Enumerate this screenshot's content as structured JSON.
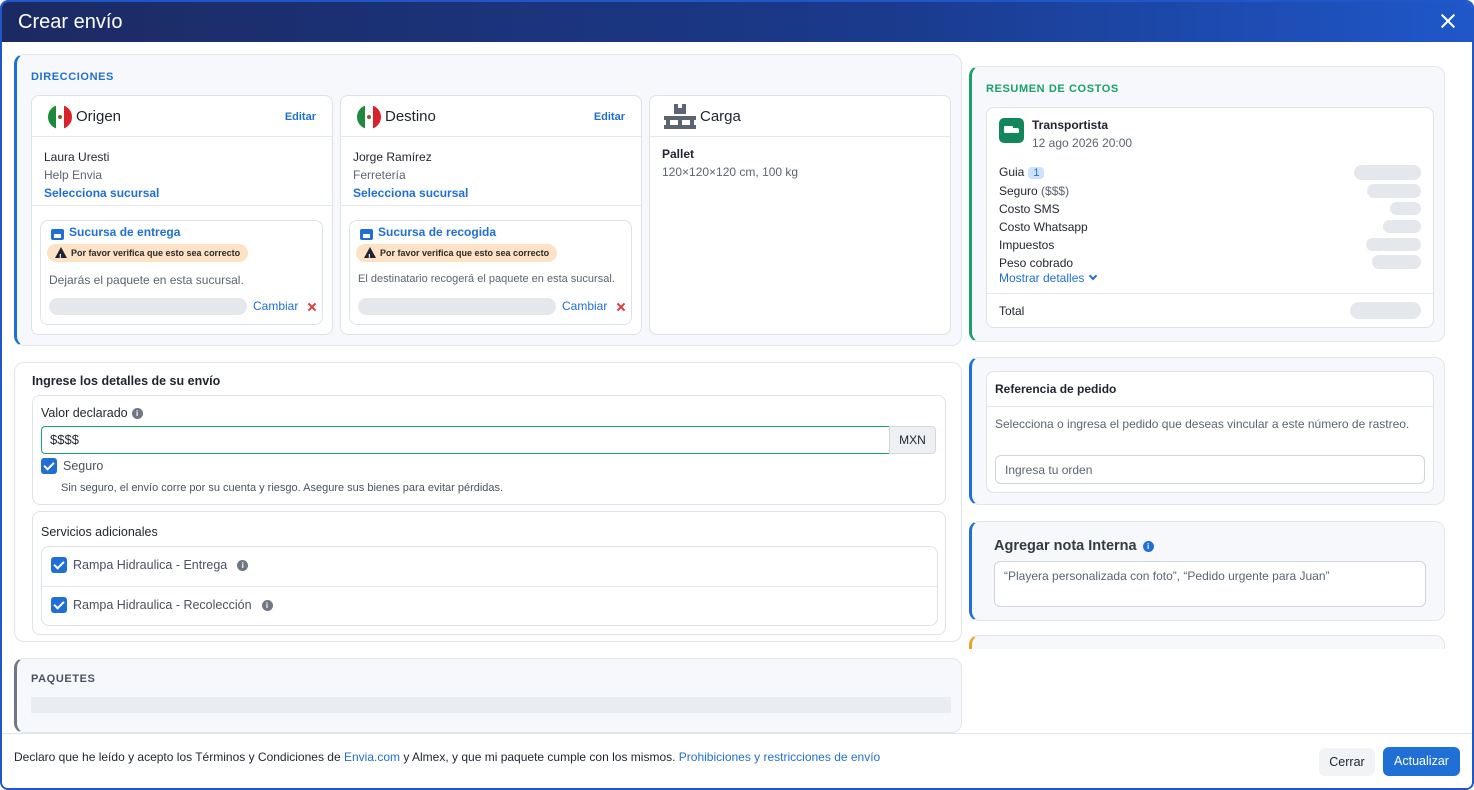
{
  "header": {
    "title": "Crear envío"
  },
  "directions": {
    "section_label": "DIRECCIONES",
    "origin": {
      "title": "Origen",
      "edit": "Editar",
      "name": "Laura Uresti",
      "company": "Help Envia",
      "select_branch": "Selecciona sucursal",
      "branch": {
        "title": "Sucursa de entrega",
        "warning": "Por favor verifica que esto sea correcto",
        "text": "Dejarás el paquete en esta sucursal.",
        "change": "Cambiar"
      }
    },
    "destination": {
      "title": "Destino",
      "edit": "Editar",
      "name": "Jorge Ramírez",
      "company": "Ferretería",
      "select_branch": "Selecciona sucursal",
      "branch": {
        "title": "Sucursa de recogida",
        "warning": "Por favor verifica que esto sea correcto",
        "text": "El destinatario recogerá el paquete en esta sucursal.",
        "change": "Cambiar"
      }
    },
    "cargo": {
      "title": "Carga",
      "type": "Pallet",
      "dims": "120×120×120 cm, 100 kg"
    }
  },
  "details": {
    "title": "Ingrese los detalles de su envío",
    "declared_label": "Valor declarado",
    "declared_value": "$$$$",
    "currency": "MXN",
    "insurance_label": "Seguro",
    "insurance_checked": true,
    "insurance_hint": "Sin seguro, el envío corre por su cuenta y riesgo. Asegure sus bienes para evitar pérdidas.",
    "services_title": "Servicios adicionales",
    "services": [
      {
        "label": "Rampa Hidraulica - Entrega",
        "checked": true
      },
      {
        "label": "Rampa Hidraulica - Recolección",
        "checked": true
      }
    ]
  },
  "packages": {
    "section_label": "PAQUETES"
  },
  "costs": {
    "section_label": "RESUMEN DE COSTOS",
    "carrier": "Transportista",
    "date": "12 ago 2026 20:00",
    "guide_label": "Guia",
    "guide_badge": "1",
    "insurance_label": "Seguro",
    "insurance_suffix": "($$$)",
    "sms_label": "Costo SMS",
    "whatsapp_label": "Costo Whatsapp",
    "taxes_label": "Impuestos",
    "weight_label": "Peso cobrado",
    "show_details": "Mostrar detalles",
    "total_label": "Total"
  },
  "order_ref": {
    "title": "Referencia de pedido",
    "description": "Selecciona o ingresa el pedido que deseas vincular a este número de rastreo.",
    "placeholder": "Ingresa tu orden"
  },
  "note": {
    "title": "Agregar nota Interna",
    "placeholder": "“Playera personalizada con foto”, “Pedido urgente para Juan”"
  },
  "footer": {
    "text_1": "Declaro que he leído y acepto los Términos y Condiciones de ",
    "link_1": "Envia.com",
    "text_2": " y Almex, y que mi paquete cumple con los mismos. ",
    "link_2": "Prohibiciones y restricciones de envío",
    "close": "Cerrar",
    "update": "Actualizar"
  },
  "colors": {
    "primary": "#1f6fd6",
    "success": "#19a06b",
    "header_dark": "#1c2a63",
    "warning_bg": "#fde2c5"
  }
}
